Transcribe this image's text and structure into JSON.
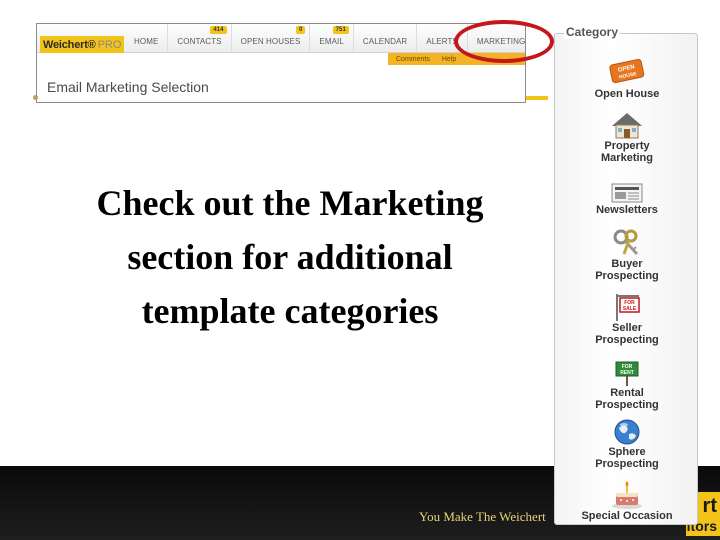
{
  "app": {
    "logo_main": "Weichert®",
    "logo_sub": "PRO",
    "nav": [
      {
        "label": "HOME",
        "badge": ""
      },
      {
        "label": "CONTACTS",
        "badge": "414"
      },
      {
        "label": "OPEN HOUSES",
        "badge": "0"
      },
      {
        "label": "EMAIL",
        "badge": "751"
      },
      {
        "label": "CALENDAR",
        "badge": ""
      },
      {
        "label": "ALERTS",
        "badge": ""
      },
      {
        "label": "MARKETING",
        "badge": ""
      }
    ],
    "subnav": [
      "Comments",
      "Help"
    ],
    "page_heading": "Email Marketing Selection"
  },
  "callout": {
    "line1": "Check out the Marketing",
    "line2": "section for additional",
    "line3": "template categories"
  },
  "category_panel": {
    "title": "Category",
    "items": [
      {
        "icon": "open-house-sign-icon",
        "label_lines": [
          "Open House"
        ]
      },
      {
        "icon": "house-icon",
        "label_lines": [
          "Property",
          "Marketing"
        ]
      },
      {
        "icon": "newspaper-icon",
        "label_lines": [
          "Newsletters"
        ]
      },
      {
        "icon": "keys-icon",
        "label_lines": [
          "Buyer",
          "Prospecting"
        ]
      },
      {
        "icon": "for-sale-sign-icon",
        "label_lines": [
          "Seller",
          "Prospecting"
        ]
      },
      {
        "icon": "for-rent-sign-icon",
        "label_lines": [
          "Rental",
          "Prospecting"
        ]
      },
      {
        "icon": "globe-icon",
        "label_lines": [
          "Sphere",
          "Prospecting"
        ]
      },
      {
        "icon": "cake-icon",
        "label_lines": [
          "Special Occasion"
        ]
      }
    ],
    "open_house_sign_text": "OPEN HOUSE",
    "for_sale_sign_text": "FOR SALE",
    "for_rent_sign_text": "FOR RENT"
  },
  "footer": {
    "tagline": "You Make The Weichert",
    "logo_line1": "rt",
    "logo_line2": "ltors"
  },
  "colors": {
    "brand_yellow": "#f2c318",
    "highlight_red": "#c4161c",
    "footer_dark": "#111111"
  }
}
